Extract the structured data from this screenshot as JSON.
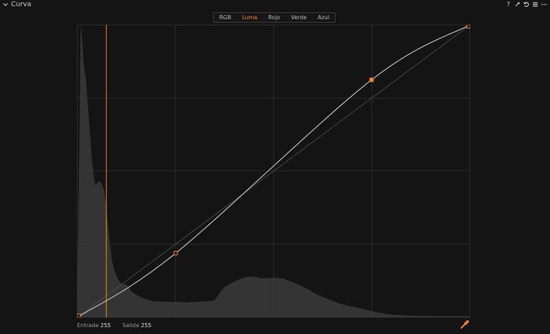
{
  "panel": {
    "title": "Curva",
    "tools": [
      "help-icon",
      "pin-icon",
      "reset-icon",
      "menu-icon",
      "more-icon"
    ]
  },
  "channels": {
    "tabs": [
      {
        "label": "RGB",
        "active": false
      },
      {
        "label": "Luma",
        "active": true
      },
      {
        "label": "Rojo",
        "active": false
      },
      {
        "label": "Verde",
        "active": false
      },
      {
        "label": "Azul",
        "active": false
      }
    ]
  },
  "curve": {
    "points": [
      {
        "input": 0,
        "output": 0
      },
      {
        "input": 64,
        "output": 56
      },
      {
        "input": 191,
        "output": 207
      },
      {
        "input": 255,
        "output": 255
      }
    ],
    "cursor_input": 19,
    "accent": "#ff8a1e"
  },
  "footer": {
    "input_label": "Entrada",
    "input_value": "255",
    "output_label": "Salida",
    "output_value": "255"
  }
}
